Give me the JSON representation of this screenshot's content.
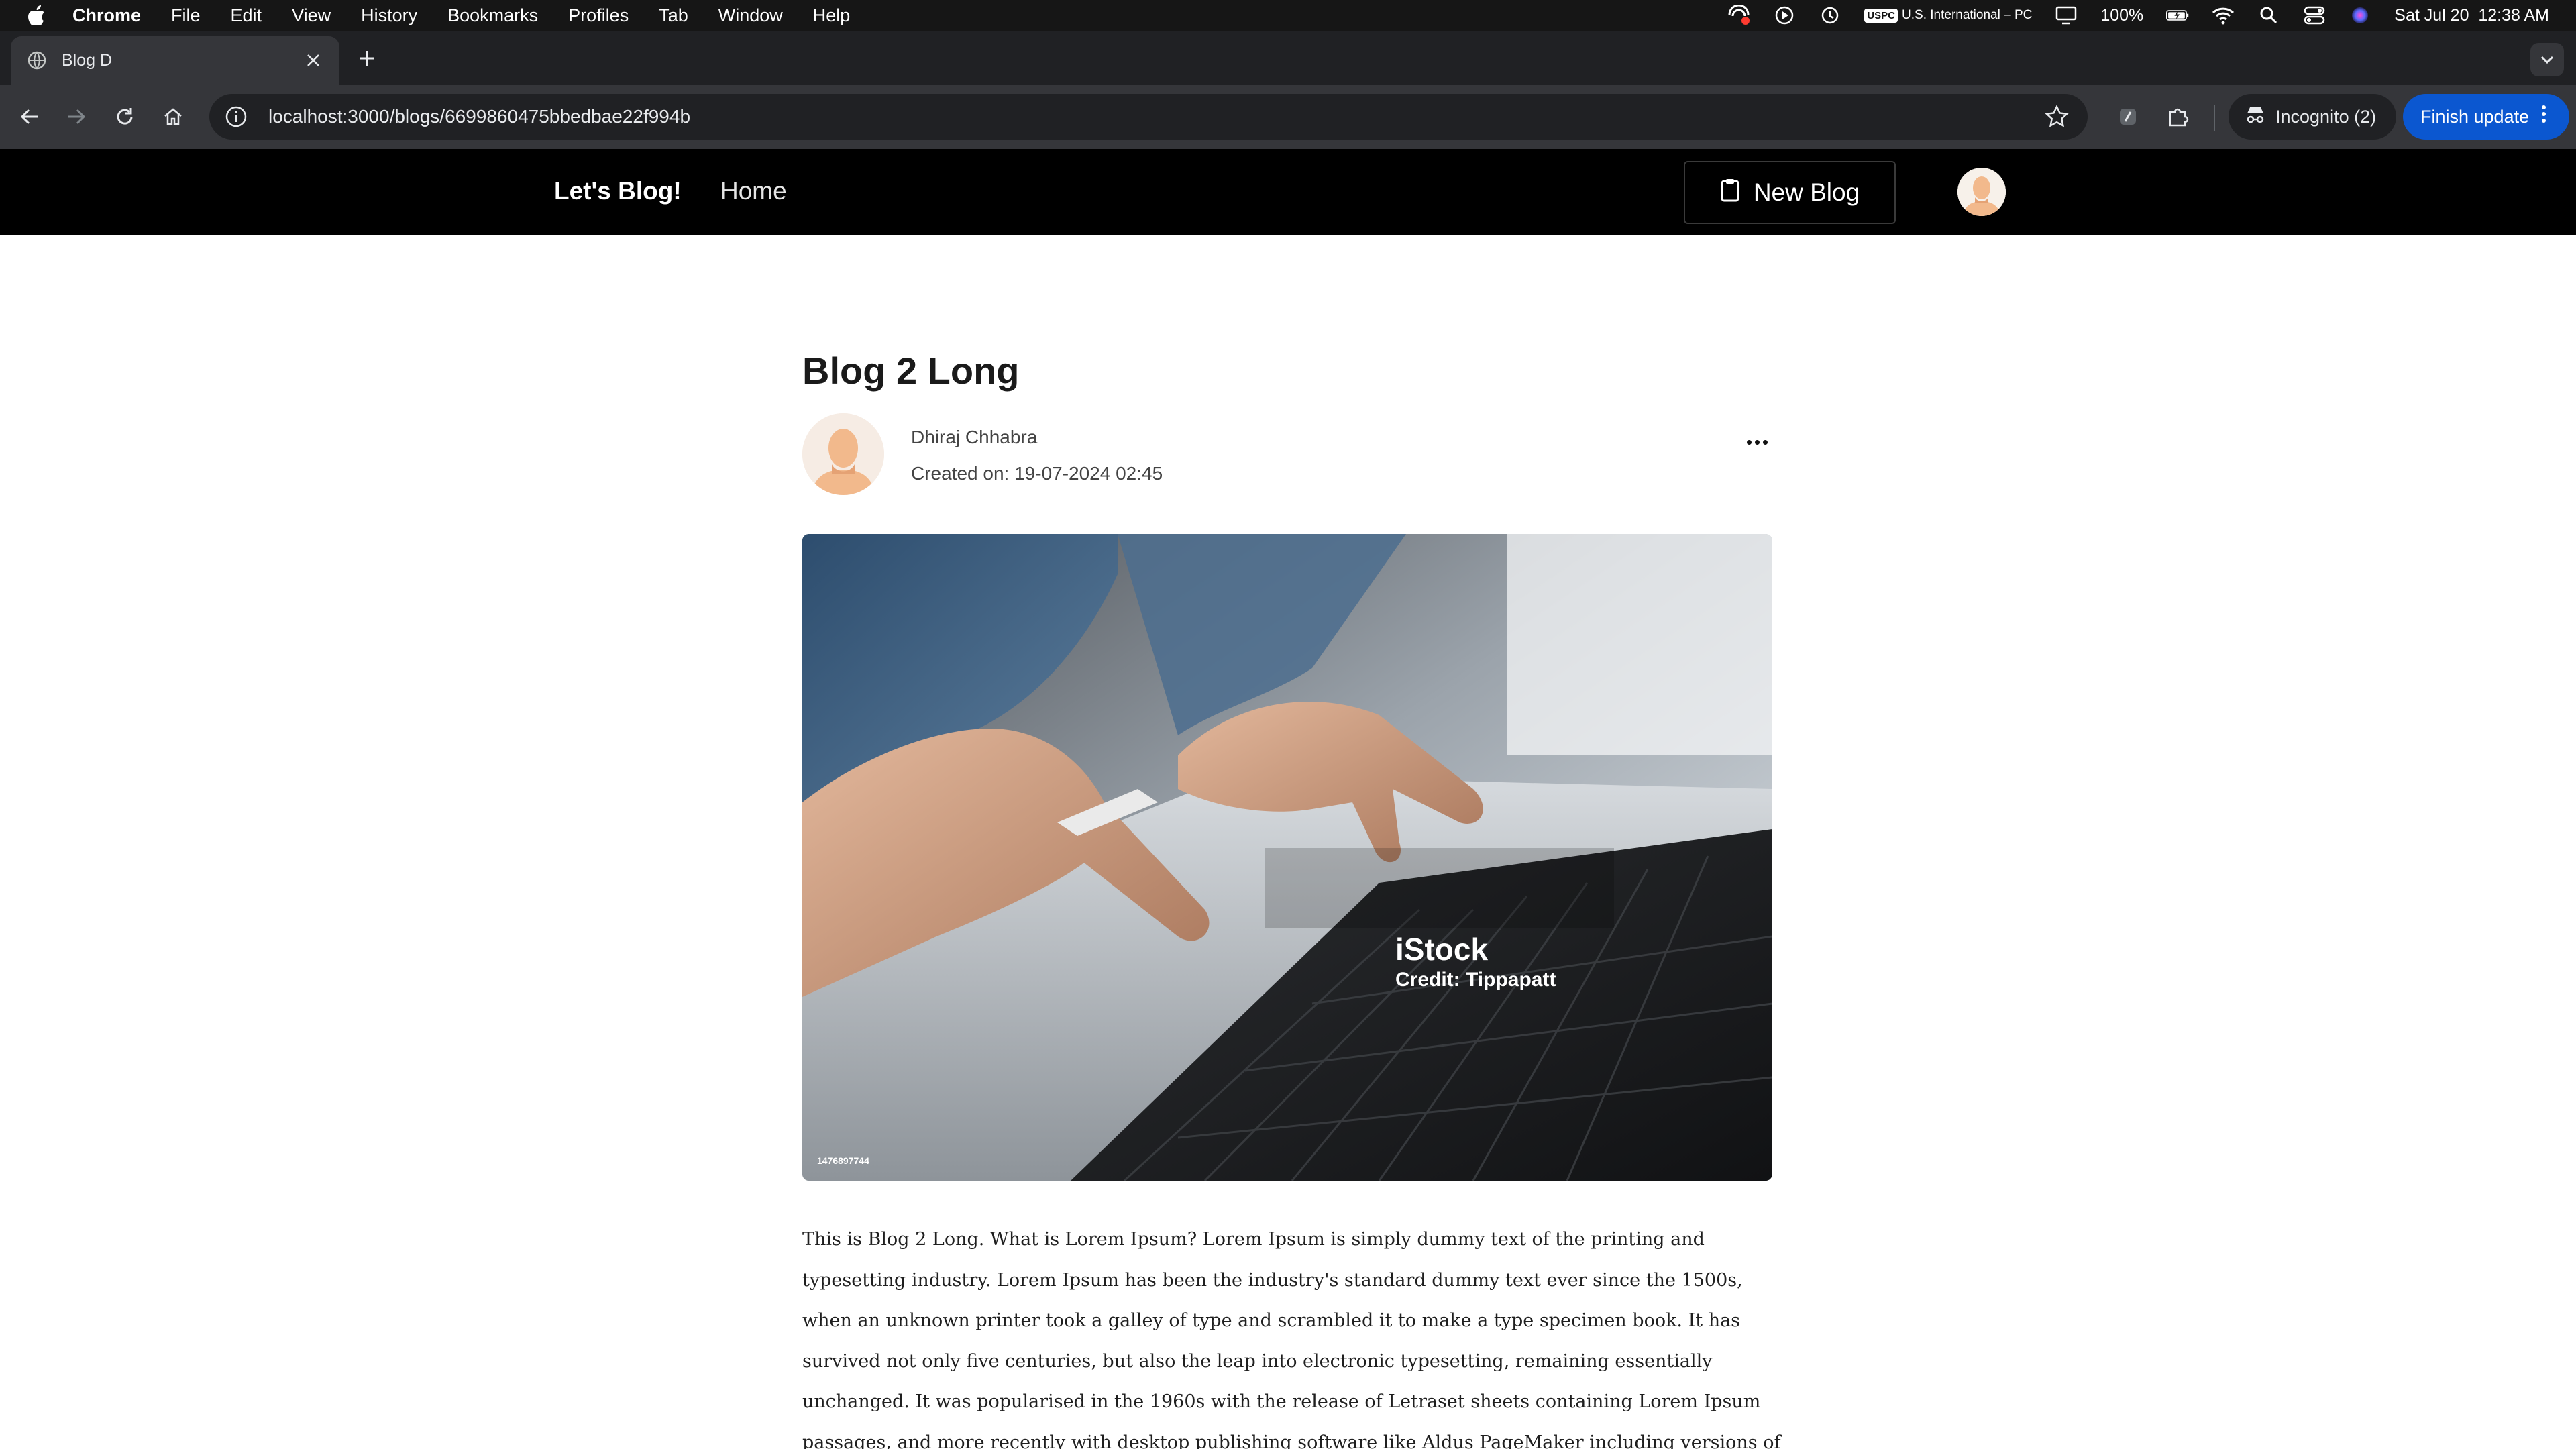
{
  "menubar": {
    "app_name": "Chrome",
    "items": [
      "File",
      "Edit",
      "View",
      "History",
      "Bookmarks",
      "Profiles",
      "Tab",
      "Window",
      "Help"
    ],
    "keyboard_badge": "USPC",
    "keyboard_label": "U.S. International – PC",
    "battery": "100%",
    "datetime": "Sat Jul 20  12:38 AM"
  },
  "browser": {
    "tab_title": "Blog D",
    "url": "localhost:3000/blogs/6699860475bbedbae22f994b",
    "incognito_label": "Incognito (2)",
    "update_label": "Finish update"
  },
  "site": {
    "brand": "Let's Blog!",
    "home_link": "Home",
    "new_blog_label": "New Blog"
  },
  "post": {
    "title": "Blog 2 Long",
    "author": "Dhiraj Chhabra",
    "created": "Created on: 19-07-2024 02:45",
    "image_watermark": "iStock",
    "image_credit": "Credit: Tippapatt",
    "image_id": "1476897744",
    "body": "This is Blog 2 Long. What is Lorem Ipsum? Lorem Ipsum is simply dummy text of the printing and typesetting industry. Lorem Ipsum has been the industry's standard dummy text ever since the 1500s, when an unknown printer took a galley of type and scrambled it to make a type specimen book. It has survived not only five centuries, but also the leap into electronic typesetting, remaining essentially unchanged. It was popularised in the 1960s with the release of Letraset sheets containing Lorem Ipsum passages, and more recently with desktop publishing software like Aldus PageMaker including versions of Lorem Ipsum. Why do we use it? It is a long established fact that a reader will be"
  },
  "colors": {
    "menubar_bg": "#161616",
    "tabstrip_bg": "#202124",
    "toolbar_bg": "#35363a",
    "update_button": "#0b57d0",
    "site_nav_bg": "#000000"
  },
  "icons": [
    "apple-icon",
    "screen-record-icon",
    "play-icon",
    "time-machine-icon",
    "display-icon",
    "battery-icon",
    "wifi-icon",
    "spotlight-icon",
    "control-center-icon",
    "siri-icon",
    "globe-icon",
    "close-icon",
    "plus-icon",
    "chevron-down-icon",
    "back-icon",
    "forward-icon",
    "reload-icon",
    "home-icon",
    "info-icon",
    "star-icon",
    "extension-icon",
    "puzzle-icon",
    "incognito-icon",
    "clipboard-icon",
    "more-icon"
  ]
}
